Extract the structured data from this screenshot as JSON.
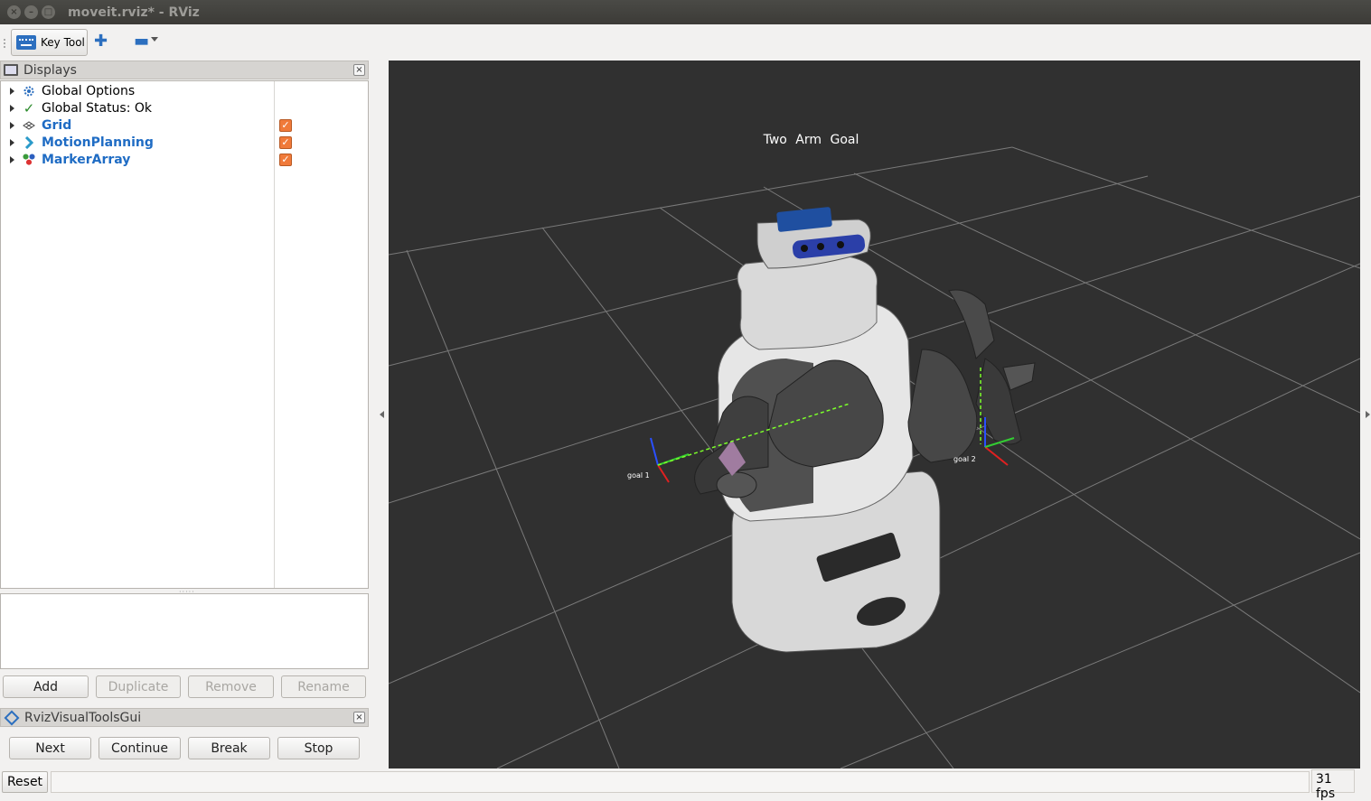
{
  "window": {
    "title": "moveit.rviz* - RViz"
  },
  "toolbar": {
    "key_tool_label": "Key Tool"
  },
  "displays": {
    "title": "Displays",
    "items": [
      {
        "label": "Global Options",
        "icon": "gear-icon",
        "checked": null
      },
      {
        "label": "Global Status: Ok",
        "icon": "checkmark-icon",
        "checked": null
      },
      {
        "label": "Grid",
        "icon": "grid-icon",
        "checked": true
      },
      {
        "label": "MotionPlanning",
        "icon": "motion-planning-icon",
        "checked": true
      },
      {
        "label": "MarkerArray",
        "icon": "marker-array-icon",
        "checked": true
      }
    ],
    "buttons": {
      "add": "Add",
      "duplicate": "Duplicate",
      "remove": "Remove",
      "rename": "Rename"
    }
  },
  "rviz_visual_tools": {
    "title": "RvizVisualToolsGui",
    "buttons": {
      "next": "Next",
      "continue": "Continue",
      "break": "Break",
      "stop": "Stop"
    }
  },
  "view": {
    "title": "Two  Arm  Goal",
    "goal_labels": [
      "goal 1",
      "goal 2"
    ]
  },
  "status": {
    "reset_label": "Reset",
    "fps": "31 fps"
  },
  "colors": {
    "accent": "#1f6cc4",
    "checkbox": "#f07a3a",
    "view_bg": "#303030",
    "grid": "#7a7a7a"
  }
}
